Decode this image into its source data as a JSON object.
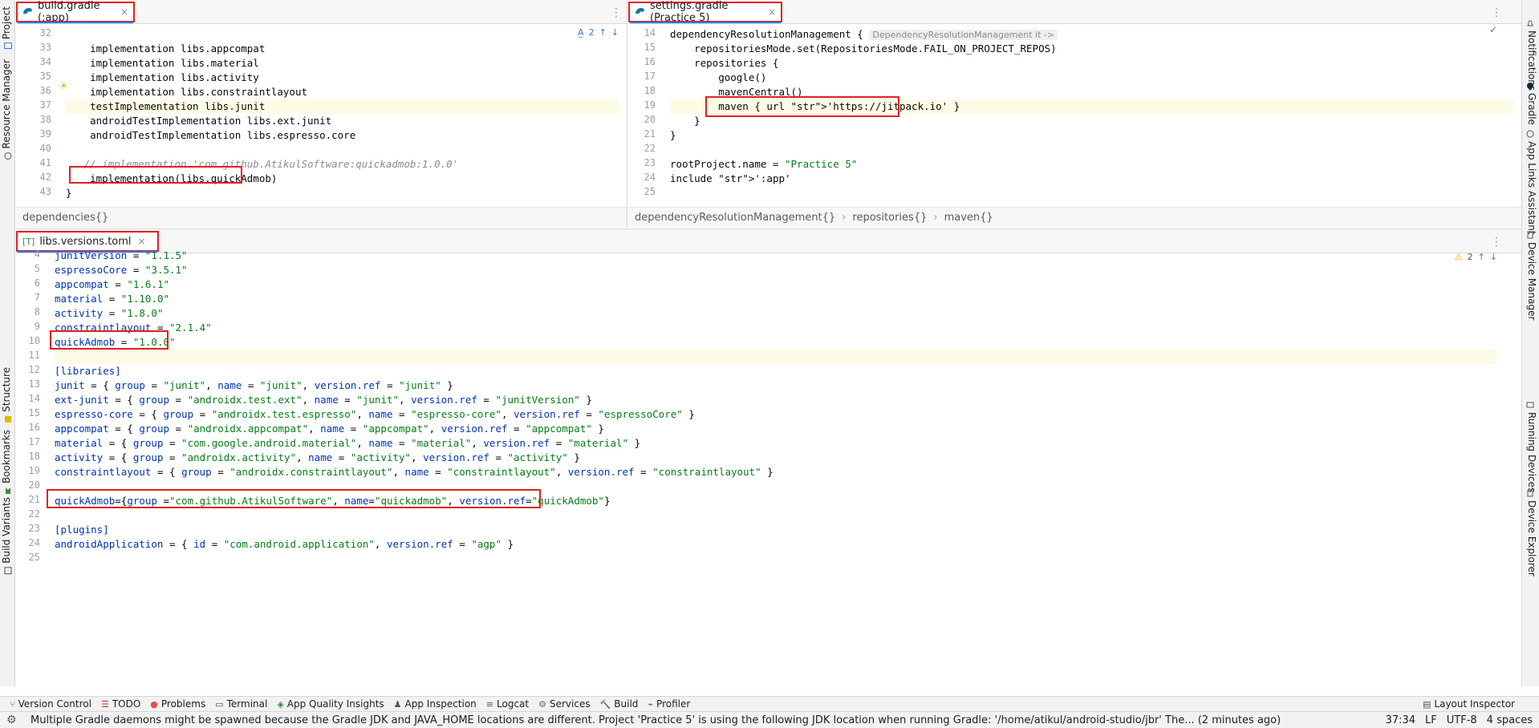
{
  "left_strip": {
    "top": [
      {
        "icon": "folder-icon",
        "label": "Project"
      },
      {
        "icon": "resource-icon",
        "label": "Resource Manager"
      }
    ],
    "bottom": [
      {
        "icon": "structure-icon",
        "label": "Structure"
      },
      {
        "icon": "bookmark-icon",
        "label": "Bookmarks"
      },
      {
        "icon": "build-variants-icon",
        "label": "Build Variants"
      }
    ]
  },
  "right_strip": [
    {
      "icon": "bell-icon",
      "label": "Notifications"
    },
    {
      "icon": "gradle-icon",
      "label": "Gradle"
    },
    {
      "icon": "app-links-icon",
      "label": "App Links Assistant"
    },
    {
      "icon": "device-manager-icon",
      "label": "Device Manager"
    },
    {
      "icon": "running-devices-icon",
      "label": "Running Devices"
    },
    {
      "icon": "device-explorer-icon",
      "label": "Device Explorer"
    }
  ],
  "editor_build": {
    "tab": {
      "icon": "gradle-icon",
      "label": "build.gradle (:app)",
      "close": "×"
    },
    "inspection": {
      "count": "2"
    },
    "lines": [
      {
        "n": "32",
        "text": ""
      },
      {
        "n": "33",
        "text": "    implementation libs.appcompat"
      },
      {
        "n": "34",
        "text": "    implementation libs.material"
      },
      {
        "n": "35",
        "text": "    implementation libs.activity"
      },
      {
        "n": "36",
        "text": "    implementation libs.constraintlayout"
      },
      {
        "n": "37",
        "text": "    testImplementation libs.junit"
      },
      {
        "n": "38",
        "text": "    androidTestImplementation libs.ext.junit"
      },
      {
        "n": "39",
        "text": "    androidTestImplementation libs.espresso.core"
      },
      {
        "n": "40",
        "text": ""
      },
      {
        "n": "41",
        "text": "   // implementation 'com.github.AtikulSoftware:quickadmob:1.0.0'"
      },
      {
        "n": "42",
        "text": "    implementation(libs.quickAdmob)"
      },
      {
        "n": "43",
        "text": "}"
      }
    ],
    "breadcrumb": [
      "dependencies{}"
    ]
  },
  "editor_settings": {
    "tab": {
      "icon": "gradle-icon",
      "label": "settings.gradle (Practice 5)",
      "close": "×"
    },
    "lines": [
      {
        "n": "14",
        "code": "dependencyResolutionManagement {",
        "hint": "DependencyResolutionManagement it ->"
      },
      {
        "n": "15",
        "code": "    repositoriesMode.set(RepositoriesMode.FAIL_ON_PROJECT_REPOS)"
      },
      {
        "n": "16",
        "code": "    repositories {"
      },
      {
        "n": "17",
        "code": "        google()"
      },
      {
        "n": "18",
        "code": "        mavenCentral()"
      },
      {
        "n": "19",
        "code": "        maven { url 'https://jitpack.io' }"
      },
      {
        "n": "20",
        "code": "    }"
      },
      {
        "n": "21",
        "code": "}"
      },
      {
        "n": "22",
        "code": ""
      },
      {
        "n": "23",
        "code": "rootProject.name = \"Practice 5\""
      },
      {
        "n": "24",
        "code": "include ':app'"
      },
      {
        "n": "25",
        "code": ""
      }
    ],
    "breadcrumb": [
      "dependencyResolutionManagement{}",
      "repositories{}",
      "maven{}"
    ]
  },
  "editor_toml": {
    "tab": {
      "icon": "toml-icon",
      "label": "libs.versions.toml",
      "close": "×"
    },
    "inspection": {
      "count": "2"
    },
    "lines": [
      {
        "n": "4",
        "code": "junitVersion = \"1.1.5\""
      },
      {
        "n": "5",
        "code": "espressoCore = \"3.5.1\""
      },
      {
        "n": "6",
        "code": "appcompat = \"1.6.1\""
      },
      {
        "n": "7",
        "code": "material = \"1.10.0\""
      },
      {
        "n": "8",
        "code": "activity = \"1.8.0\""
      },
      {
        "n": "9",
        "code": "constraintlayout = \"2.1.4\""
      },
      {
        "n": "10",
        "code": "quickAdmob = \"1.0.0\""
      },
      {
        "n": "11",
        "code": ""
      },
      {
        "n": "12",
        "code": "[libraries]"
      },
      {
        "n": "13",
        "code": "junit = { group = \"junit\", name = \"junit\", version.ref = \"junit\" }"
      },
      {
        "n": "14",
        "code": "ext-junit = { group = \"androidx.test.ext\", name = \"junit\", version.ref = \"junitVersion\" }"
      },
      {
        "n": "15",
        "code": "espresso-core = { group = \"androidx.test.espresso\", name = \"espresso-core\", version.ref = \"espressoCore\" }"
      },
      {
        "n": "16",
        "code": "appcompat = { group = \"androidx.appcompat\", name = \"appcompat\", version.ref = \"appcompat\" }"
      },
      {
        "n": "17",
        "code": "material = { group = \"com.google.android.material\", name = \"material\", version.ref = \"material\" }"
      },
      {
        "n": "18",
        "code": "activity = { group = \"androidx.activity\", name = \"activity\", version.ref = \"activity\" }"
      },
      {
        "n": "19",
        "code": "constraintlayout = { group = \"androidx.constraintlayout\", name = \"constraintlayout\", version.ref = \"constraintlayout\" }"
      },
      {
        "n": "20",
        "code": ""
      },
      {
        "n": "21",
        "code": "quickAdmob={group =\"com.github.AtikulSoftware\", name=\"quickadmob\", version.ref=\"quickAdmob\"}"
      },
      {
        "n": "22",
        "code": ""
      },
      {
        "n": "23",
        "code": "[plugins]"
      },
      {
        "n": "24",
        "code": "androidApplication = { id = \"com.android.application\", version.ref = \"agp\" }"
      },
      {
        "n": "25",
        "code": ""
      }
    ]
  },
  "tool_windows": [
    {
      "icon": "vcs-icon",
      "label": "Version Control"
    },
    {
      "icon": "todo-icon",
      "label": "TODO"
    },
    {
      "icon": "problems-icon",
      "label": "Problems"
    },
    {
      "icon": "terminal-icon",
      "label": "Terminal"
    },
    {
      "icon": "app-quality-icon",
      "label": "App Quality Insights"
    },
    {
      "icon": "app-inspection-icon",
      "label": "App Inspection"
    },
    {
      "icon": "logcat-icon",
      "label": "Logcat"
    },
    {
      "icon": "services-icon",
      "label": "Services"
    },
    {
      "icon": "build-icon",
      "label": "Build"
    },
    {
      "icon": "profiler-icon",
      "label": "Profiler"
    }
  ],
  "layout_inspector": "Layout Inspector",
  "status": {
    "message": "Multiple Gradle daemons might be spawned because the Gradle JDK and JAVA_HOME locations are different. Project 'Practice 5' is using the following JDK location when running Gradle: '/home/atikul/android-studio/jbr' The... (2 minutes ago)",
    "position": "37:34",
    "line_sep": "LF",
    "encoding": "UTF-8",
    "indent": "4 spaces"
  },
  "colors": {
    "highlight_box": "#e02020",
    "accent": "#3574f0",
    "string": "#067d17",
    "keyword": "#0033b3"
  }
}
